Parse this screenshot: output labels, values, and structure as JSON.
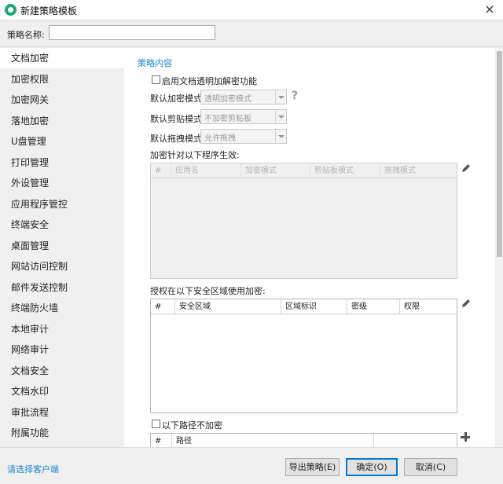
{
  "window": {
    "title": "新建策略模板",
    "close_glyph": "×"
  },
  "form": {
    "name_label": "策略名称:",
    "name_value": ""
  },
  "sidebar": {
    "items": [
      {
        "label": "文档加密",
        "active": true
      },
      {
        "label": "加密权限"
      },
      {
        "label": "加密网关"
      },
      {
        "label": "落地加密"
      },
      {
        "label": "U盘管理"
      },
      {
        "label": "打印管理"
      },
      {
        "label": "外设管理"
      },
      {
        "label": "应用程序管控"
      },
      {
        "label": "终端安全"
      },
      {
        "label": "桌面管理"
      },
      {
        "label": "网站访问控制"
      },
      {
        "label": "邮件发送控制"
      },
      {
        "label": "终端防火墙"
      },
      {
        "label": "本地审计"
      },
      {
        "label": "网络审计"
      },
      {
        "label": "文档安全"
      },
      {
        "label": "文档水印"
      },
      {
        "label": "审批流程"
      },
      {
        "label": "附属功能"
      }
    ]
  },
  "content": {
    "section_title": "策略内容",
    "enable_transparent": {
      "label": "启用文档透明加解密功能",
      "checked": false
    },
    "default_encrypt_mode": {
      "label": "默认加密模式",
      "value": "透明加密模式"
    },
    "default_clipboard_mode": {
      "label": "默认剪贴模式",
      "value": "不加密剪贴板"
    },
    "default_drag_mode": {
      "label": "默认拖拽模式",
      "value": "允许拖拽"
    },
    "programs_label": "加密针对以下程序生效:",
    "programs_columns": [
      "#",
      "应用名",
      "加密模式",
      "剪贴板模式",
      "拖拽模式"
    ],
    "zones_label": "授权在以下安全区域使用加密:",
    "zones_columns": [
      "#",
      "安全区域",
      "区域标识",
      "密级",
      "权限"
    ],
    "exclude_paths": {
      "label": "以下路径不加密",
      "checked": false
    },
    "paths_columns": [
      "#",
      "路径"
    ]
  },
  "footer": {
    "select_client_link": "请选择客户端",
    "export_button": "导出策略(E)",
    "ok_button": "确定(O)",
    "cancel_button": "取消(C)"
  },
  "icons": {
    "app": "app-logo-icon",
    "help": "question-icon",
    "edit": "pencil-icon",
    "add": "plus-icon"
  },
  "colors": {
    "accent": "#1a87c9",
    "app_icon": "#1aa57a",
    "default_button_border": "#0078d7"
  }
}
